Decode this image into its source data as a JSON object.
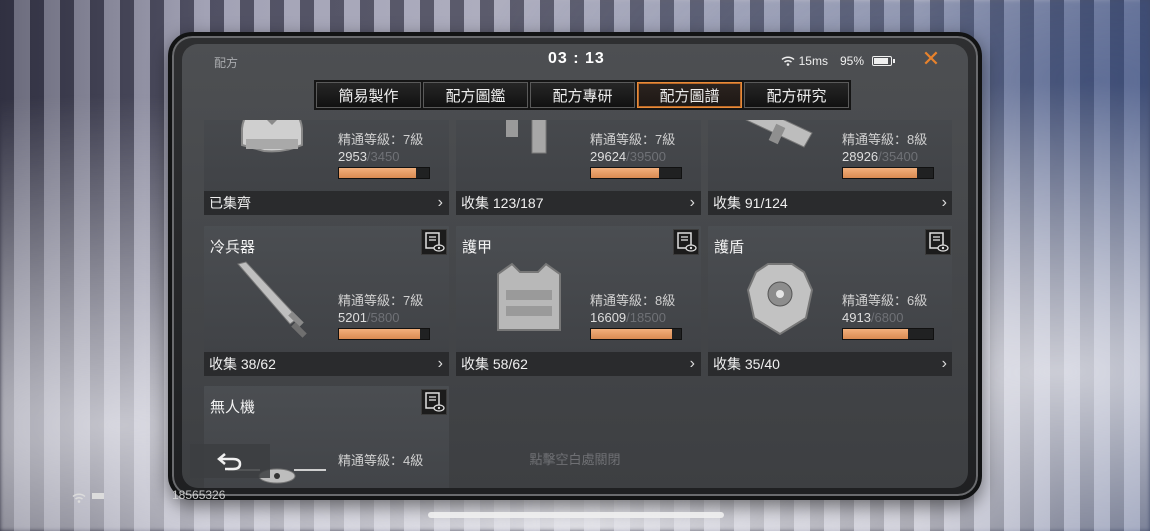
{
  "window": {
    "title": "配方",
    "clock": "03 : 13",
    "ping": "15ms",
    "battery": "95%"
  },
  "tabs": [
    {
      "label": "簡易製作",
      "active": false
    },
    {
      "label": "配方圖鑑",
      "active": false
    },
    {
      "label": "配方專研",
      "active": false
    },
    {
      "label": "配方圖譜",
      "active": true
    },
    {
      "label": "配方研究",
      "active": false
    }
  ],
  "cards": [
    {
      "name": "",
      "icon": "helmet-icon",
      "mastery": "精通等級：7級",
      "current": "2953",
      "max": "3450",
      "progress": 0.86,
      "collect": "已集齊"
    },
    {
      "name": "",
      "icon": "smg-icon",
      "mastery": "精通等級：7級",
      "current": "29624",
      "max": "39500",
      "progress": 0.75,
      "collect": "收集 123/187"
    },
    {
      "name": "",
      "icon": "launcher-icon",
      "mastery": "精通等級：8級",
      "current": "28926",
      "max": "35400",
      "progress": 0.82,
      "collect": "收集 91/124"
    },
    {
      "name": "冷兵器",
      "icon": "sword-icon",
      "mastery": "精通等級：7級",
      "current": "5201",
      "max": "5800",
      "progress": 0.9,
      "collect": "收集 38/62"
    },
    {
      "name": "護甲",
      "icon": "armor-vest-icon",
      "mastery": "精通等級：8級",
      "current": "16609",
      "max": "18500",
      "progress": 0.9,
      "collect": "收集 58/62"
    },
    {
      "name": "護盾",
      "icon": "shield-icon",
      "mastery": "精通等級：6級",
      "current": "4913",
      "max": "6800",
      "progress": 0.72,
      "collect": "收集 35/40"
    },
    {
      "name": "無人機",
      "icon": "drone-icon",
      "mastery": "精通等級：4級",
      "current": "",
      "max": "",
      "progress": 0,
      "collect": ""
    }
  ],
  "footer": {
    "hint": "點擊空白處關閉"
  },
  "device": {
    "id": "18565326"
  },
  "colors": {
    "accent": "#e8822c",
    "bar": "#e3986a"
  }
}
